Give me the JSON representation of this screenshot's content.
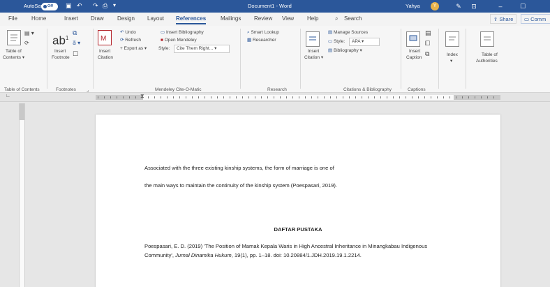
{
  "titlebar": {
    "autosave": "AutoSave",
    "autosave_state": "Off",
    "document": "Document1",
    "app": "Word",
    "user": "Yahya",
    "user_initial": "Y"
  },
  "tabs": [
    "File",
    "Home",
    "Insert",
    "Draw",
    "Design",
    "Layout",
    "References",
    "Mailings",
    "Review",
    "View",
    "Help"
  ],
  "active_tab": "References",
  "search_label": "Search",
  "share_label": "Share",
  "comments_label": "Comm",
  "ribbon": {
    "toc": {
      "label1": "Table of",
      "label2": "Contents",
      "group": "Table of Contents"
    },
    "footnotes": {
      "ab_label": "ab",
      "ab_sup": "1",
      "insert1": "Insert",
      "insert2": "Footnote",
      "group": "Footnotes"
    },
    "mendeley": {
      "insert1": "Insert",
      "insert2": "Citation",
      "undo": "Undo",
      "refresh": "Refresh",
      "export": "Export as",
      "insert_bib": "Insert Bibliography",
      "open_mendeley": "Open Mendeley",
      "style_label": "Style:",
      "style_value": "Cite Them Right...",
      "group": "Mendeley Cite-O-Matic"
    },
    "research": {
      "smart_lookup": "Smart Lookup",
      "researcher": "Researcher",
      "group": "Research"
    },
    "citations": {
      "insert1": "Insert",
      "insert2": "Citation",
      "manage": "Manage Sources",
      "style_label": "Style:",
      "style_value": "APA",
      "bibliography": "Bibliography",
      "group": "Citations & Bibliography"
    },
    "captions": {
      "insert1": "Insert",
      "insert2": "Caption",
      "group": "Captions"
    },
    "index": {
      "label": "Index"
    },
    "authorities": {
      "label1": "Table of",
      "label2": "Authorities"
    }
  },
  "document": {
    "para_line1": "Associated with the three existing kinship systems, the form of marriage is one of",
    "para_line2": "the main ways to maintain the continuity of the kinship system (Poespasari, 2019).",
    "heading": "DAFTAR PUSTAKA",
    "ref_part1": "Poespasari, E. D. (2019) 'The Position of Mamak Kepala Waris in High Ancestral Inheritance in Minangkabau Indigenous Community',",
    "ref_journal": "Jurnal Dinamika Hukum",
    "ref_part2": ", 19(1), pp. 1–18. doi: 10.20884/1.JDH.2019.19.1.2214."
  },
  "colors": {
    "accent": "#2b579a",
    "mendeley_red": "#b4232a"
  }
}
